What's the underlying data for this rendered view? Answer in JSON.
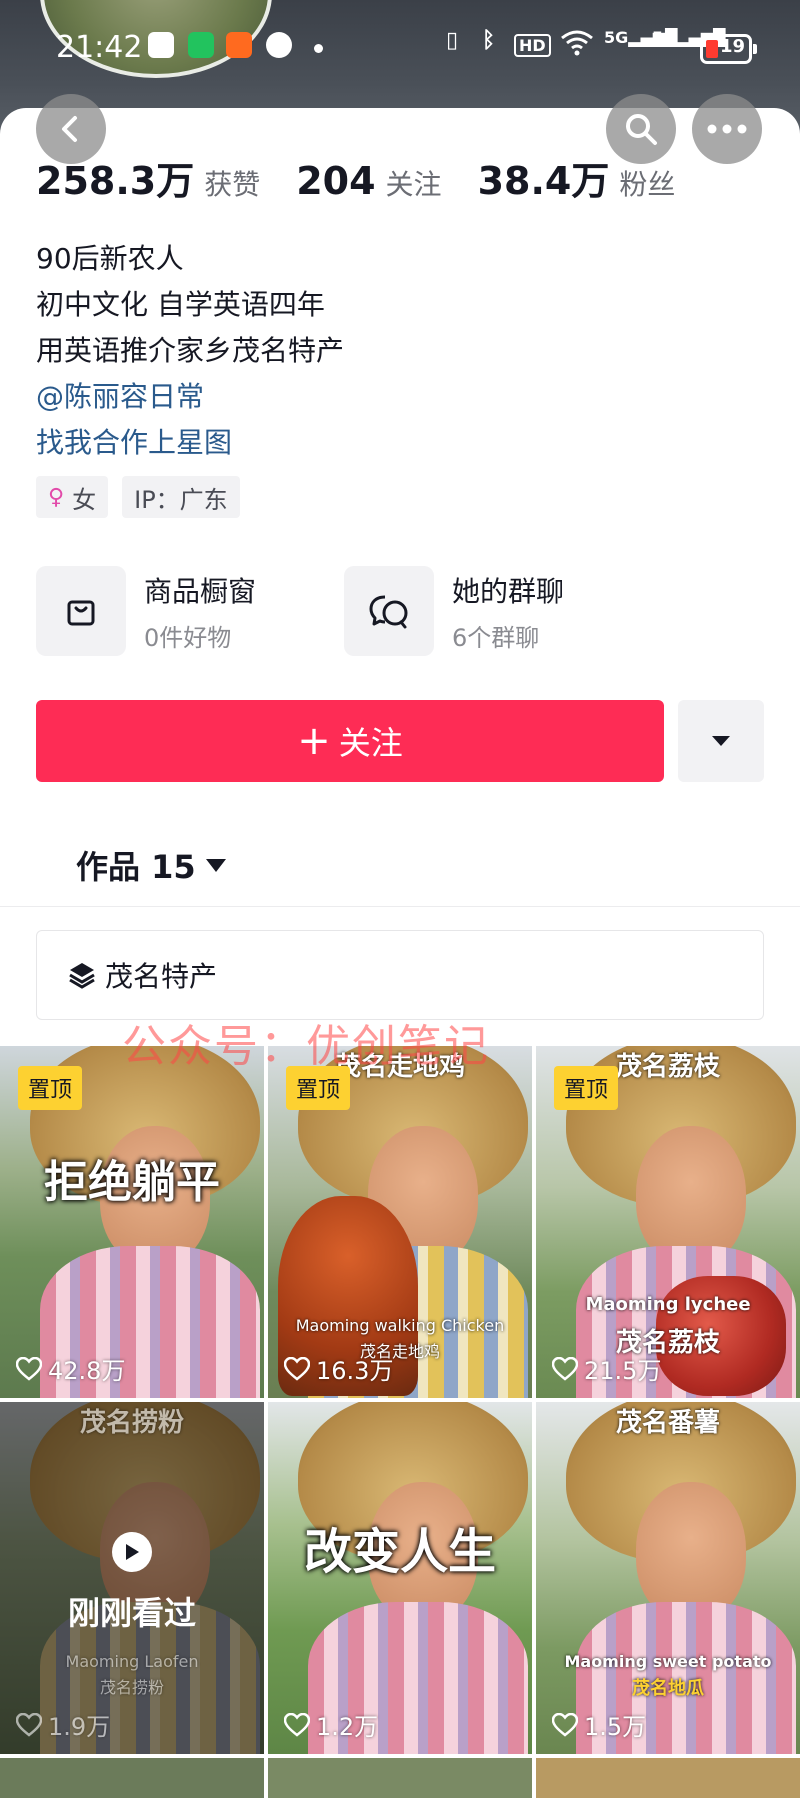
{
  "status_bar": {
    "time": "21:42",
    "network_1": "5G",
    "network_2": "5G",
    "battery": "19"
  },
  "header": {
    "back_icon": "chevron-left-icon",
    "search_icon": "search-icon",
    "more_icon": "more-horizontal-icon"
  },
  "stats": [
    {
      "value": "258.3万",
      "label": "获赞"
    },
    {
      "value": "204",
      "label": "关注"
    },
    {
      "value": "38.4万",
      "label": "粉丝"
    }
  ],
  "bio": {
    "lines": [
      "90后新农人",
      "初中文化 自学英语四年",
      "用英语推介家乡茂名特产"
    ],
    "mention": "@陈丽容日常",
    "cooperation": "找我合作上星图"
  },
  "tags": {
    "gender": "女",
    "ip": "IP：广东"
  },
  "entries": [
    {
      "title": "商品橱窗",
      "subtitle": "0件好物",
      "icon": "shopping-bag-icon"
    },
    {
      "title": "她的群聊",
      "subtitle": "6个群聊",
      "icon": "group-chat-icon"
    }
  ],
  "follow": {
    "label": "关注"
  },
  "works": {
    "label": "作品 15"
  },
  "collection": {
    "label": "茂名特产",
    "icon": "layers-icon"
  },
  "watermark": "公众号：优创笔记",
  "videos": [
    {
      "pinned": "置顶",
      "caption": "拒绝躺平",
      "likes": "42.8万"
    },
    {
      "pinned": "置顶",
      "top_caption": "茂名走地鸡",
      "caption_en": "Maoming walking Chicken",
      "caption_cn": "茂名走地鸡",
      "likes": "16.3万"
    },
    {
      "pinned": "置顶",
      "top_caption": "茂名荔枝",
      "caption_en": "Maoming lychee",
      "caption_cn": "茂名荔枝",
      "likes": "21.5万"
    },
    {
      "top_caption": "茂名捞粉",
      "caption_en": "Maoming Laofen",
      "caption_cn": "茂名捞粉",
      "watched": "刚刚看过",
      "likes": "1.9万"
    },
    {
      "caption": "改变人生",
      "likes": "1.2万"
    },
    {
      "top_caption": "茂名番薯",
      "caption_en": "Maoming sweet potato",
      "caption_cn": "茂名地瓜",
      "likes": "1.5万"
    }
  ]
}
